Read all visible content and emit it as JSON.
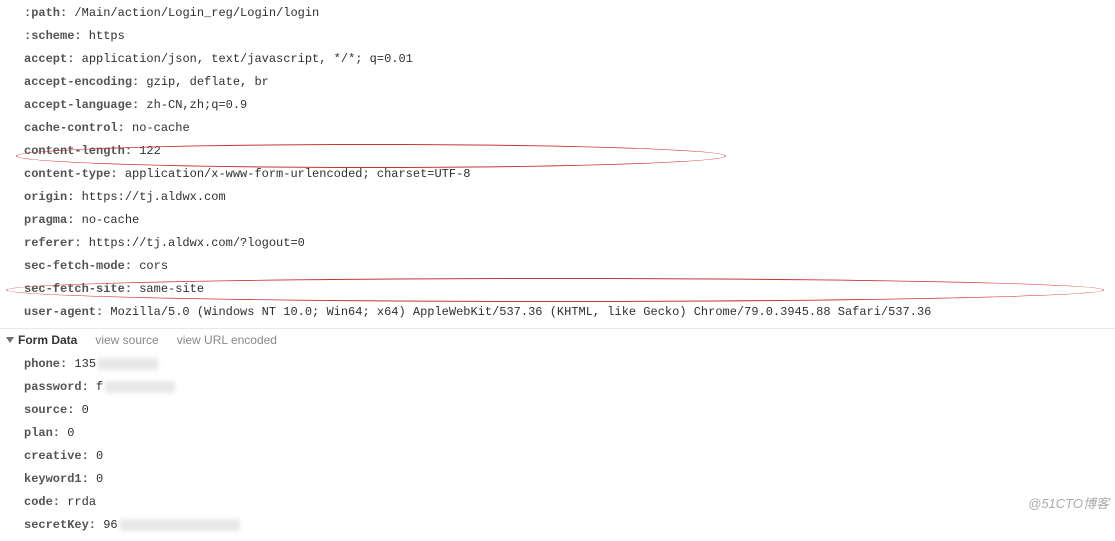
{
  "headers": [
    {
      "name": ":path:",
      "value": "/Main/action/Login_reg/Login/login"
    },
    {
      "name": ":scheme:",
      "value": "https"
    },
    {
      "name": "accept:",
      "value": "application/json, text/javascript, */*; q=0.01"
    },
    {
      "name": "accept-encoding:",
      "value": "gzip, deflate, br"
    },
    {
      "name": "accept-language:",
      "value": "zh-CN,zh;q=0.9"
    },
    {
      "name": "cache-control:",
      "value": "no-cache"
    },
    {
      "name": "content-length:",
      "value": "122"
    },
    {
      "name": "content-type:",
      "value": "application/x-www-form-urlencoded; charset=UTF-8"
    },
    {
      "name": "origin:",
      "value": "https://tj.aldwx.com"
    },
    {
      "name": "pragma:",
      "value": "no-cache"
    },
    {
      "name": "referer:",
      "value": "https://tj.aldwx.com/?logout=0"
    },
    {
      "name": "sec-fetch-mode:",
      "value": "cors"
    },
    {
      "name": "sec-fetch-site:",
      "value": "same-site"
    },
    {
      "name": "user-agent:",
      "value": "Mozilla/5.0 (Windows NT 10.0; Win64; x64) AppleWebKit/537.36 (KHTML, like Gecko) Chrome/79.0.3945.88 Safari/537.36"
    }
  ],
  "formSection": {
    "title": "Form Data",
    "viewSource": "view source",
    "viewUrlEncoded": "view URL encoded"
  },
  "formData": [
    {
      "name": "phone:",
      "value": "135",
      "blurred": true,
      "blurWidth": 60
    },
    {
      "name": "password:",
      "value": "f",
      "blurred": true,
      "blurWidth": 70
    },
    {
      "name": "source:",
      "value": "0",
      "blurred": false
    },
    {
      "name": "plan:",
      "value": "0",
      "blurred": false
    },
    {
      "name": "creative:",
      "value": "0",
      "blurred": false
    },
    {
      "name": "keyword1:",
      "value": "0",
      "blurred": false
    },
    {
      "name": "code:",
      "value": "rrda",
      "blurred": false
    },
    {
      "name": "secretKey:",
      "value": "96",
      "blurred": true,
      "blurWidth": 120
    }
  ],
  "watermark": "@51CTO博客"
}
